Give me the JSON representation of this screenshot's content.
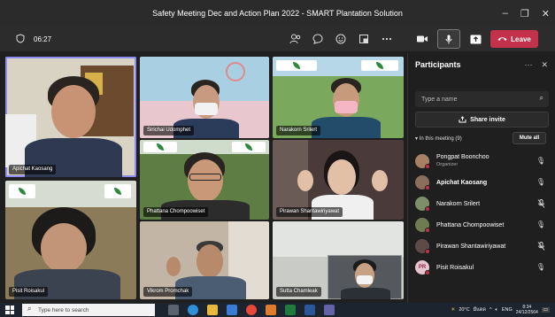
{
  "window": {
    "title": "Safety Meeting Dec and Action Plan 2022 - SMART Plantation Solution",
    "controls": [
      "–",
      "❐",
      "✕"
    ]
  },
  "toolbar": {
    "timer": "06:27",
    "leave_label": "Leave"
  },
  "tiles": [
    {
      "name": "Apichat Kaosang"
    },
    {
      "name": "Sirichai Udomphet"
    },
    {
      "name": "Narakorn Srilert"
    },
    {
      "name": "Phattana Chompoowiset"
    },
    {
      "name": "Pirawan Shantawiriyawat"
    },
    {
      "name": "Pisit Roisakul"
    },
    {
      "name": "Vikrom Promchak"
    },
    {
      "name": "Sutta Chamleak"
    }
  ],
  "participants_panel": {
    "title": "Participants",
    "search_placeholder": "Type a name",
    "share_invite_label": "Share invite",
    "in_meeting_label": "In this meeting (9)",
    "mute_all_label": "Mute all",
    "people": [
      {
        "name": "Pongpat Boonchoo",
        "role": "Organizer",
        "mic": "on",
        "initials": ""
      },
      {
        "name": "Apichat Kaosang",
        "role": "",
        "mic": "on",
        "initials": ""
      },
      {
        "name": "Narakorn Srilert",
        "role": "",
        "mic": "muted",
        "initials": ""
      },
      {
        "name": "Phattana Chompoowiset",
        "role": "",
        "mic": "on",
        "initials": ""
      },
      {
        "name": "Pirawan Shantawiriyawat",
        "role": "",
        "mic": "muted",
        "initials": ""
      },
      {
        "name": "Pisit Roisakul",
        "role": "",
        "mic": "on",
        "initials": "PR"
      }
    ]
  },
  "taskbar": {
    "search_placeholder": "Type here to search",
    "weather": "20°C",
    "weather_desc": "มีแดด",
    "language": "ENG",
    "time": "8:34",
    "date": "24/12/2564"
  },
  "colors": {
    "leave": "#c4314b",
    "active_speaker": "#8f8cf5",
    "plantation_green": "#2c8a3a"
  }
}
